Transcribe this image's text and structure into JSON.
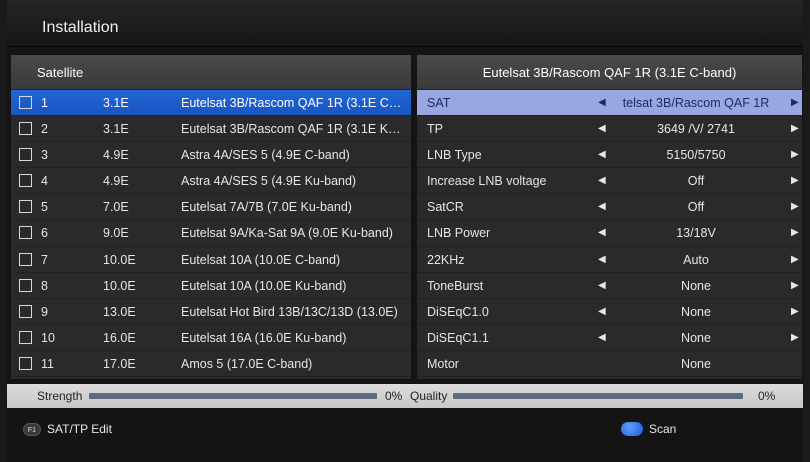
{
  "title": "Installation",
  "satellite_panel": {
    "header": "Satellite",
    "rows": [
      {
        "num": "1",
        "pos": "3.1E",
        "name": "Eutelsat 3B/Rascom QAF 1R (3.1E C-b..."
      },
      {
        "num": "2",
        "pos": "3.1E",
        "name": "Eutelsat 3B/Rascom QAF 1R (3.1E Ku-..."
      },
      {
        "num": "3",
        "pos": "4.9E",
        "name": "Astra 4A/SES 5 (4.9E C-band)"
      },
      {
        "num": "4",
        "pos": "4.9E",
        "name": "Astra 4A/SES 5 (4.9E Ku-band)"
      },
      {
        "num": "5",
        "pos": "7.0E",
        "name": "Eutelsat 7A/7B (7.0E Ku-band)"
      },
      {
        "num": "6",
        "pos": "9.0E",
        "name": "Eutelsat 9A/Ka-Sat 9A (9.0E Ku-band)"
      },
      {
        "num": "7",
        "pos": "10.0E",
        "name": "Eutelsat 10A (10.0E C-band)"
      },
      {
        "num": "8",
        "pos": "10.0E",
        "name": "Eutelsat 10A (10.0E Ku-band)"
      },
      {
        "num": "9",
        "pos": "13.0E",
        "name": "Eutelsat Hot Bird 13B/13C/13D (13.0E)"
      },
      {
        "num": "10",
        "pos": "16.0E",
        "name": "Eutelsat 16A (16.0E Ku-band)"
      },
      {
        "num": "11",
        "pos": "17.0E",
        "name": "Amos 5 (17.0E C-band)"
      }
    ]
  },
  "settings_panel": {
    "header": "Eutelsat 3B/Rascom QAF 1R (3.1E C-band)",
    "rows": [
      {
        "label": "SAT",
        "value": "telsat 3B/Rascom QAF 1R"
      },
      {
        "label": "TP",
        "value": "3649 /V/ 2741"
      },
      {
        "label": "LNB Type",
        "value": "5150/5750"
      },
      {
        "label": "Increase LNB voltage",
        "value": "Off"
      },
      {
        "label": "SatCR",
        "value": "Off"
      },
      {
        "label": "LNB Power",
        "value": "13/18V"
      },
      {
        "label": "22KHz",
        "value": "Auto"
      },
      {
        "label": "ToneBurst",
        "value": "None"
      },
      {
        "label": "DiSEqC1.0",
        "value": "None"
      },
      {
        "label": "DiSEqC1.1",
        "value": "None"
      },
      {
        "label": "Motor",
        "value": "None"
      }
    ]
  },
  "signal": {
    "strength_label": "Strength",
    "strength_value": "0%",
    "quality_label": "Quality",
    "quality_value": "0%"
  },
  "footer": {
    "f1_badge": "F1",
    "f1_label": "SAT/TP Edit",
    "scan_label": "Scan"
  },
  "colors": {
    "selected_row": "#1f66d6",
    "selected_setting_row": "#9aa6e0",
    "scan_button": "#1a5ad8"
  }
}
